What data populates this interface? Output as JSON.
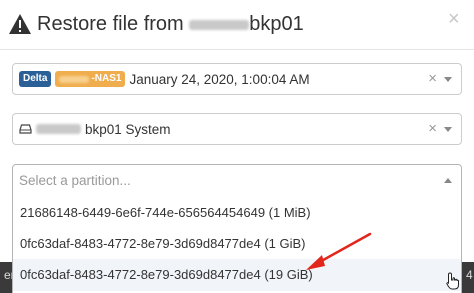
{
  "modal": {
    "title_prefix": "Restore file from ",
    "title_suffix": "bkp01",
    "close_symbol": "×",
    "icon": "warning-icon"
  },
  "snapshot_select": {
    "badge_type": "Delta",
    "badge_host_suffix": "-NAS1",
    "value": "January 24, 2020, 1:00:04 AM",
    "clear_symbol": "×",
    "colors": {
      "badge_type": "#2a5f98",
      "badge_host": "#f0ad4e"
    }
  },
  "disk_select": {
    "icon": "drive-icon",
    "host_suffix": "bkp01 System",
    "clear_symbol": "×"
  },
  "partition_select": {
    "placeholder": "Select a partition...",
    "options": [
      {
        "label": "21686148-6449-6e6f-744e-656564454649 (1 MiB)"
      },
      {
        "label": "0fc63daf-8483-4772-8e79-3d69d8477de4 (1 GiB)"
      },
      {
        "label": "0fc63daf-8483-4772-8e79-3d69d8477de4 (19 GiB)",
        "highlighted": true
      }
    ]
  },
  "background": {
    "left_fragment": "er",
    "right_fragment": "4"
  },
  "annotation": {
    "color": "#e3261c"
  }
}
